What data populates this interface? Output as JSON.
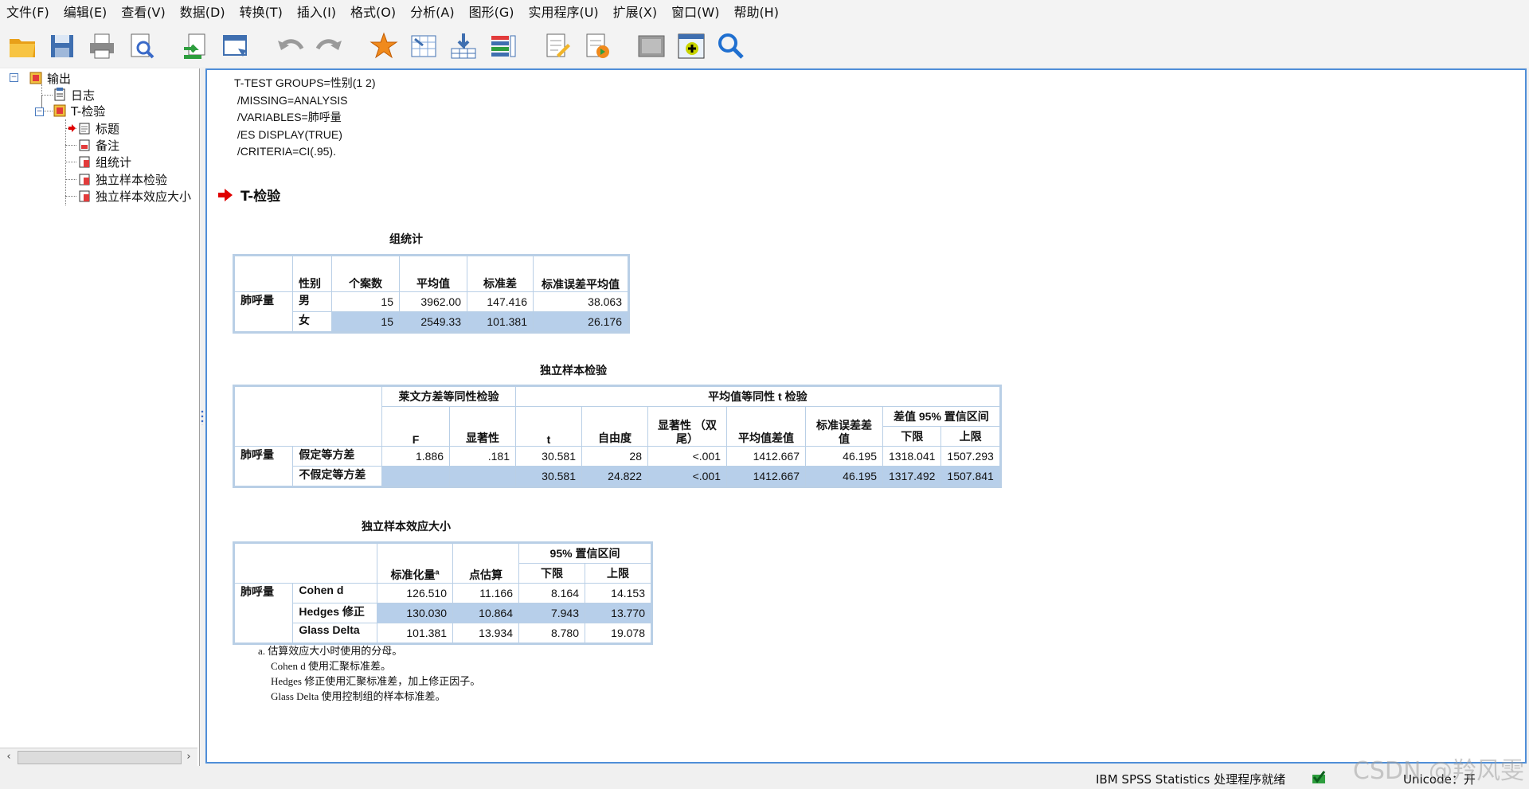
{
  "menu": [
    "文件(F)",
    "编辑(E)",
    "查看(V)",
    "数据(D)",
    "转换(T)",
    "插入(I)",
    "格式(O)",
    "分析(A)",
    "图形(G)",
    "实用程序(U)",
    "扩展(X)",
    "窗口(W)",
    "帮助(H)"
  ],
  "toolbar_icons": [
    "open-folder-icon",
    "save-icon",
    "print-icon",
    "print-preview-icon",
    "export-icon",
    "recall-dialog-icon",
    "undo-icon",
    "redo-icon",
    "goto-data-icon",
    "goto-case-icon",
    "designate-window-icon",
    "variables-icon",
    "edit-output-icon",
    "insert-output-icon",
    "image-icon",
    "new-output-icon",
    "search-icon"
  ],
  "tree": {
    "root": "输出",
    "log": "日志",
    "ttest": "T-检验",
    "children": [
      "标题",
      "备注",
      "组统计",
      "独立样本检验",
      "独立样本效应大小"
    ]
  },
  "syntax": [
    "T-TEST GROUPS=性别(1 2)",
    " /MISSING=ANALYSIS",
    " /VARIABLES=肺呼量",
    " /ES DISPLAY(TRUE)",
    " /CRITERIA=CI(.95)."
  ],
  "section_title": "T-检验",
  "group_stats": {
    "title": "组统计",
    "headers": [
      "性别",
      "个案数",
      "平均值",
      "标准差",
      "标准误差平均值"
    ],
    "var": "肺呼量",
    "rows": [
      {
        "group": "男",
        "n": "15",
        "mean": "3962.00",
        "sd": "147.416",
        "se": "38.063"
      },
      {
        "group": "女",
        "n": "15",
        "mean": "2549.33",
        "sd": "101.381",
        "se": "26.176"
      }
    ]
  },
  "ind_test": {
    "title": "独立样本检验",
    "levene_hdr": "莱文方差等同性检验",
    "ttest_hdr": "平均值等同性 t 检验",
    "ci_hdr": "差值 95% 置信区间",
    "cols": [
      "F",
      "显著性",
      "t",
      "自由度",
      "显著性 （双尾）",
      "平均值差值",
      "标准误差差值",
      "下限",
      "上限"
    ],
    "var": "肺呼量",
    "rows": [
      {
        "label": "假定等方差",
        "F": "1.886",
        "sig": ".181",
        "t": "30.581",
        "df": "28",
        "p": "<.001",
        "md": "1412.667",
        "sed": "46.195",
        "lo": "1318.041",
        "hi": "1507.293"
      },
      {
        "label": "不假定等方差",
        "F": "",
        "sig": "",
        "t": "30.581",
        "df": "24.822",
        "p": "<.001",
        "md": "1412.667",
        "sed": "46.195",
        "lo": "1317.492",
        "hi": "1507.841"
      }
    ]
  },
  "effect": {
    "title": "独立样本效应大小",
    "ci_hdr": "95% 置信区间",
    "cols": [
      "标准化量",
      "点估算",
      "下限",
      "上限"
    ],
    "sup": "a",
    "var": "肺呼量",
    "rows": [
      {
        "label": "Cohen d",
        "std": "126.510",
        "pt": "11.166",
        "lo": "8.164",
        "hi": "14.153"
      },
      {
        "label": "Hedges 修正",
        "std": "130.030",
        "pt": "10.864",
        "lo": "7.943",
        "hi": "13.770"
      },
      {
        "label": "Glass Delta",
        "std": "101.381",
        "pt": "13.934",
        "lo": "8.780",
        "hi": "19.078"
      }
    ],
    "footnotes": [
      "a. 估算效应大小时使用的分母。",
      "Cohen d 使用汇聚标准差。",
      "Hedges 修正使用汇聚标准差，加上修正因子。",
      "Glass Delta 使用控制组的样本标准差。"
    ]
  },
  "status": {
    "processor": "IBM SPSS Statistics 处理程序就绪",
    "unicode": "Unicode：开"
  },
  "watermark": "CSDN @羚风雯",
  "colors": {
    "accent": "#4f8ed8",
    "table_border": "#b9cfe6",
    "alt_row": "#b7cfea",
    "arrow_red": "#e00000"
  }
}
